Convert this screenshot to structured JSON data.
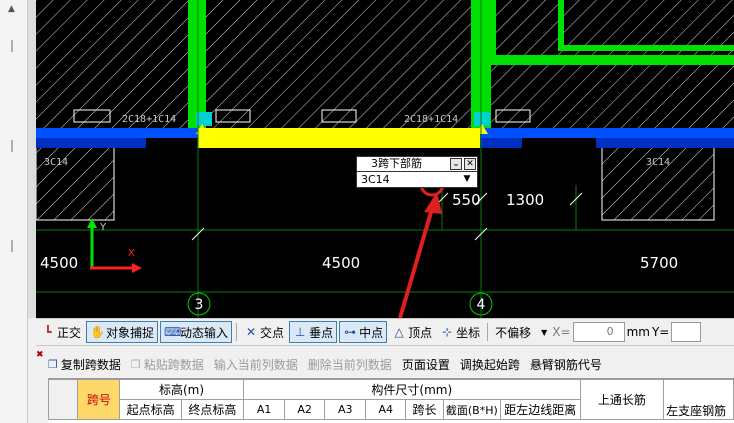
{
  "canvas": {
    "dims": {
      "left": "4500",
      "center": "4500",
      "right": "5700",
      "d550": "550",
      "d1300": "1300"
    },
    "axes": {
      "a3": "3",
      "a4": "4"
    },
    "labels": {
      "top_left": "2C18+1C14",
      "top_right": "2C18+1C14",
      "left_box": "3C14",
      "right_box": "3C14"
    },
    "ucs_y": "Y",
    "ucs_x": "X"
  },
  "popup": {
    "title": "3跨下部筋",
    "value": "3C14",
    "collapse_symbol": "⌄",
    "close_symbol": "✕",
    "dropdown_symbol": "▼"
  },
  "toolbar": {
    "ortho": "正交",
    "snap": "对象捕捉",
    "dyn_input": "动态输入",
    "intersect": "交点",
    "perp": "垂点",
    "mid": "中点",
    "vertex": "顶点",
    "coord": "坐标",
    "offset_mode": "不偏移",
    "x_label": "X=",
    "x_value": "0",
    "mm": "mm",
    "y_label": "Y="
  },
  "actions": {
    "copy_span": "复制跨数据",
    "paste_span": "粘贴跨数据",
    "input_col": "输入当前列数据",
    "delete_col": "删除当前列数据",
    "page_setup": "页面设置",
    "swap_start": "调换起始跨",
    "cantilever": "悬臂钢筋代号"
  },
  "table": {
    "span_no": "跨号",
    "elev": "标高(m)",
    "elev_start": "起点标高",
    "elev_end": "终点标高",
    "dims": "构件尺寸(mm)",
    "a1": "A1",
    "a2": "A2",
    "a3": "A3",
    "a4": "A4",
    "span_len": "跨长",
    "section": "截面(B*H)",
    "edge_dist": "距左边线距离",
    "top_through": "上通长筋",
    "left_support": "左支座钢筋"
  },
  "colors": {
    "column_green": "#00e000",
    "beam_yellow": "#ffff00",
    "beam_blue": "#0050ff",
    "highlight_cell": "#ffd86a",
    "annotation_red": "#e02020"
  }
}
